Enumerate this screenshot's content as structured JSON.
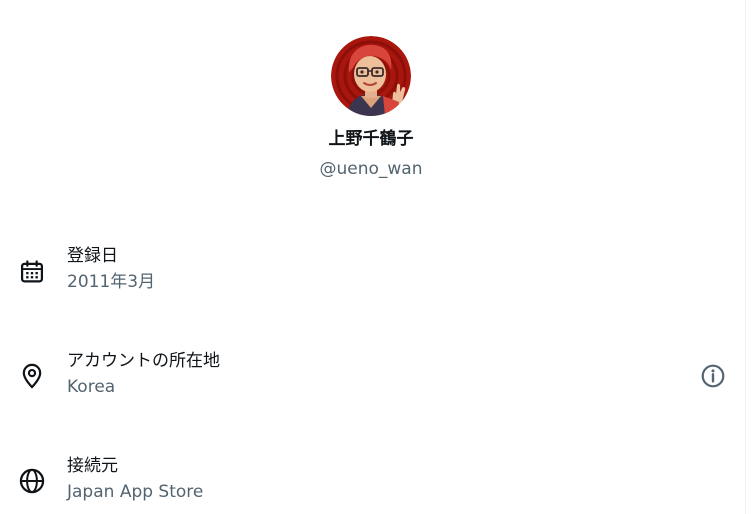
{
  "profile": {
    "display_name": "上野千鶴子",
    "handle": "@ueno_wan"
  },
  "about": {
    "joined": {
      "label": "登録日",
      "value": "2011年3月",
      "icon": "calendar-icon"
    },
    "account_location": {
      "label": "アカウントの所在地",
      "value": "Korea",
      "icon": "location-pin-icon",
      "info_icon": "info-icon"
    },
    "connected_via": {
      "label": "接続元",
      "value": "Japan App Store",
      "icon": "globe-icon"
    }
  },
  "colors": {
    "primary_text": "#0f1419",
    "secondary_text": "#536471",
    "avatar_background": "#b01c14"
  }
}
